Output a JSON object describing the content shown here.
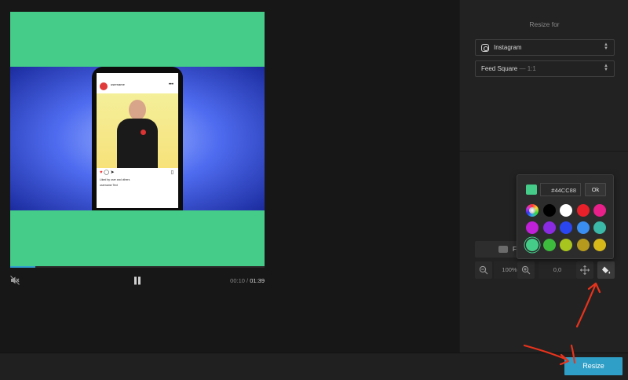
{
  "player": {
    "background_color": "#44CC88",
    "post": {
      "username": "username",
      "likes_text": "Liked by user and others",
      "caption_text": "username Text"
    },
    "progress_fraction": 0.1,
    "time_current": "00:10",
    "time_separator": "/",
    "time_total": "01:39"
  },
  "panel": {
    "resize_for_label": "Resize for",
    "platform": {
      "label": "Instagram",
      "icon": "instagram-icon"
    },
    "format": {
      "label": "Feed Square",
      "ratio": "— 1:1"
    },
    "fit_label": "Fi",
    "zoom_value": "100%",
    "position_value": "0,0"
  },
  "color_picker": {
    "hex": "#44CC88",
    "ok_label": "Ok",
    "swatches": [
      "rainbow",
      "#000000",
      "#FFFFFF",
      "#E8202A",
      "#E8208A",
      "#C020D8",
      "#8A2BE2",
      "#2A46F0",
      "#3A8EF0",
      "#3BB8A8",
      "#44CC88",
      "#3DBB3D",
      "#A8C41E",
      "#B59A1E",
      "#D6B81A"
    ]
  },
  "footer": {
    "resize_button_label": "Resize"
  },
  "colors": {
    "accent": "#2f9fc7",
    "annotation": "#e8331c"
  }
}
